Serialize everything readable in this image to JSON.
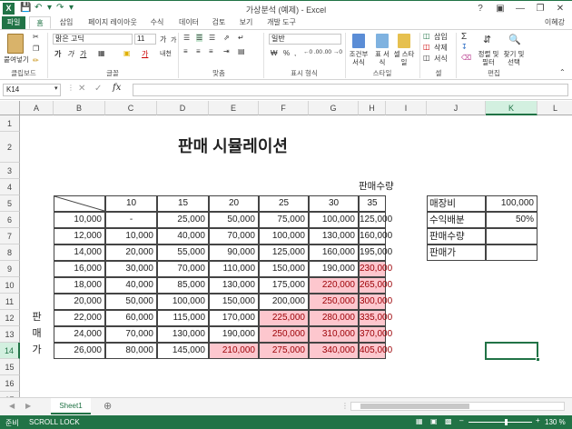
{
  "window": {
    "title": "가상분석 (예제) - Excel",
    "help": "?",
    "user": "이혜강"
  },
  "tabs": [
    "파일",
    "홈",
    "삽입",
    "페이지 레이아웃",
    "수식",
    "데이터",
    "검토",
    "보기",
    "개발 도구"
  ],
  "ribbon": {
    "clipboard": {
      "paste": "붙여넣기",
      "label": "클립보드"
    },
    "font": {
      "name": "맑은 고딕",
      "size": "11",
      "label": "글꼴",
      "bold": "가",
      "italic": "가",
      "underline": "가",
      "grow": "가",
      "shrink": "가",
      "color_glyph": "가",
      "phonetic": "내천"
    },
    "alignment": {
      "label": "맞춤"
    },
    "number": {
      "format": "일반",
      "label": "표시 형식",
      "dec_inc": "←0 .00",
      "dec_dec": ".00 →0"
    },
    "styles": {
      "conditional": "조건부 서식",
      "table": "표 서식",
      "cell": "셀 스타일",
      "label": "스타일"
    },
    "cells": {
      "insert": "삽입",
      "delete": "삭제",
      "format": "서식",
      "label": "셀"
    },
    "editing": {
      "sort": "정렬 및 필터",
      "find": "찾기 및 선택",
      "label": "편집"
    }
  },
  "formula_bar": {
    "name_box": "K14",
    "fx": "fx",
    "value": ""
  },
  "columns": [
    "A",
    "B",
    "C",
    "D",
    "E",
    "F",
    "G",
    "H",
    "I",
    "J",
    "K",
    "L"
  ],
  "rows": [
    "1",
    "2",
    "3",
    "4",
    "5",
    "6",
    "7",
    "8",
    "9",
    "10",
    "11",
    "12",
    "13",
    "14",
    "15",
    "16",
    "17"
  ],
  "sheet": {
    "title": "판매 시뮬레이션",
    "qty_caption": "판매수량",
    "price_caption_chars": [
      "판",
      "매",
      "가"
    ],
    "col_headers": [
      "10",
      "15",
      "20",
      "25",
      "30",
      "35"
    ],
    "price_rows": [
      {
        "price": "10,000",
        "values": [
          "-",
          "25,000",
          "50,000",
          "75,000",
          "100,000",
          "125,000"
        ]
      },
      {
        "price": "12,000",
        "values": [
          "10,000",
          "40,000",
          "70,000",
          "100,000",
          "130,000",
          "160,000"
        ]
      },
      {
        "price": "14,000",
        "values": [
          "20,000",
          "55,000",
          "90,000",
          "125,000",
          "160,000",
          "195,000"
        ]
      },
      {
        "price": "16,000",
        "values": [
          "30,000",
          "70,000",
          "110,000",
          "150,000",
          "190,000",
          "230,000"
        ]
      },
      {
        "price": "18,000",
        "values": [
          "40,000",
          "85,000",
          "130,000",
          "175,000",
          "220,000",
          "265,000"
        ]
      },
      {
        "price": "20,000",
        "values": [
          "50,000",
          "100,000",
          "150,000",
          "200,000",
          "250,000",
          "300,000"
        ]
      },
      {
        "price": "22,000",
        "values": [
          "60,000",
          "115,000",
          "170,000",
          "225,000",
          "280,000",
          "335,000"
        ]
      },
      {
        "price": "24,000",
        "values": [
          "70,000",
          "130,000",
          "190,000",
          "250,000",
          "310,000",
          "370,000"
        ]
      },
      {
        "price": "26,000",
        "values": [
          "80,000",
          "145,000",
          "210,000",
          "275,000",
          "340,000",
          "405,000"
        ]
      }
    ],
    "params": [
      {
        "label": "매장비",
        "value": "100,000"
      },
      {
        "label": "수익배분",
        "value": "50%"
      },
      {
        "label": "판매수량",
        "value": ""
      },
      {
        "label": "판매가",
        "value": ""
      }
    ]
  },
  "sheet_tab": "Sheet1",
  "status": {
    "ready": "준비",
    "scroll_lock": "SCROLL LOCK",
    "zoom": "130 %"
  },
  "colors": {
    "accent": "#217346",
    "highlight_fill": "#fdc7ce",
    "highlight_text": "#9c0006"
  },
  "highlight_threshold": 200000
}
